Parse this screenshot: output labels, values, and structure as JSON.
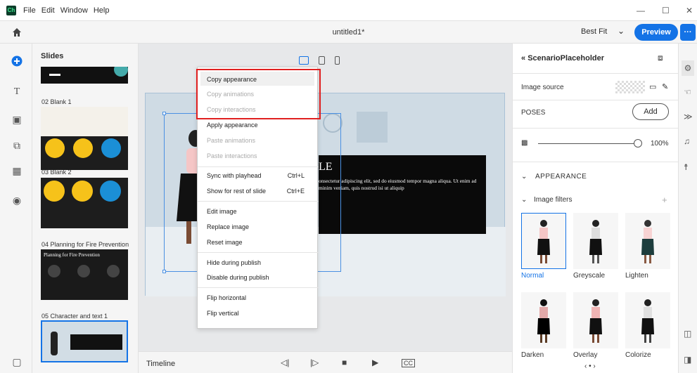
{
  "menubar": {
    "items": [
      "File",
      "Edit",
      "Window",
      "Help"
    ],
    "minimize": "—",
    "maximize": "☐",
    "close": "✕"
  },
  "header": {
    "doc_title": "untitled1*",
    "zoom": "Best Fit",
    "preview": "Preview",
    "more": "···"
  },
  "slides_panel": {
    "heading": "Slides",
    "items": [
      {
        "label": "02 Blank 1"
      },
      {
        "label": "03 Blank 2"
      },
      {
        "label": "04 Planning for Fire Prevention",
        "thumb_title": "Planning for Fire Prevention"
      },
      {
        "label": "05 Character and text 1"
      }
    ]
  },
  "slide": {
    "text_big": "LE",
    "text_body": "onsectetur adipiscing elit, sed do eiusmod tempor magna aliqua. Ut enim ad minim veniam, quis nostrud isi ut aliquip"
  },
  "context_menu": {
    "items": [
      {
        "label": "Copy appearance",
        "disabled": false
      },
      {
        "label": "Copy animations",
        "disabled": true
      },
      {
        "label": "Copy interactions",
        "disabled": true
      },
      {
        "label": "Apply appearance",
        "disabled": false
      },
      {
        "label": "Paste animations",
        "disabled": true
      },
      {
        "label": "Paste interactions",
        "disabled": true
      },
      {
        "label": "Sync with playhead",
        "shortcut": "Ctrl+L",
        "disabled": false
      },
      {
        "label": "Show for rest of slide",
        "shortcut": "Ctrl+E",
        "disabled": false
      },
      {
        "label": "Edit image",
        "disabled": false
      },
      {
        "label": "Replace image",
        "disabled": false
      },
      {
        "label": "Reset image",
        "disabled": false
      },
      {
        "label": "Hide during publish",
        "disabled": false
      },
      {
        "label": "Disable during publish",
        "disabled": false
      },
      {
        "label": "Flip horizontal",
        "disabled": false
      },
      {
        "label": "Flip vertical",
        "disabled": false
      }
    ]
  },
  "timeline": {
    "label": "Timeline"
  },
  "right_panel": {
    "title": "ScenarioPlaceholder",
    "image_source": "Image source",
    "poses": "POSES",
    "add": "Add",
    "opacity": "100%",
    "appearance": "APPEARANCE",
    "image_filters": "Image filters",
    "plus": "+",
    "filters": [
      "Normal",
      "Greyscale",
      "Lighten",
      "Darken",
      "Overlay",
      "Colorize"
    ]
  },
  "colors": {
    "accent": "#1473e6",
    "highlight": "#e02020"
  }
}
